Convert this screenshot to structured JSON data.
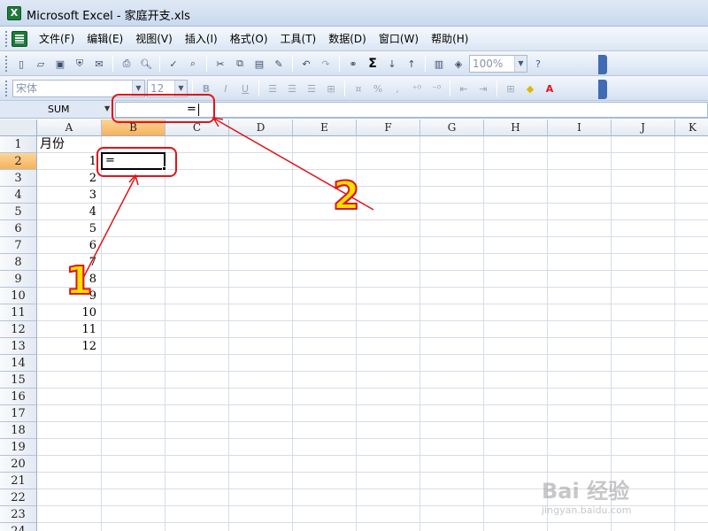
{
  "window": {
    "title": "Microsoft Excel - 家庭开支.xls",
    "app_icon": "excel-icon"
  },
  "menu": {
    "items": [
      "文件(F)",
      "编辑(E)",
      "视图(V)",
      "插入(I)",
      "格式(O)",
      "工具(T)",
      "数据(D)",
      "窗口(W)",
      "帮助(H)"
    ]
  },
  "standard_toolbar": {
    "zoom": "100%"
  },
  "format_toolbar": {
    "font_name": "宋体",
    "font_size": "12",
    "bold": "B",
    "italic": "I",
    "underline": "U",
    "percent": "%",
    "comma": ",",
    "font_color_letter": "A"
  },
  "formula_bar": {
    "name_box": "SUM",
    "content": "="
  },
  "grid": {
    "columns": [
      "A",
      "B",
      "C",
      "D",
      "E",
      "F",
      "G",
      "H",
      "I",
      "J",
      "K"
    ],
    "rows": [
      "1",
      "2",
      "3",
      "4",
      "5",
      "6",
      "7",
      "8",
      "9",
      "10",
      "11",
      "12",
      "13",
      "14",
      "15",
      "16",
      "17",
      "18",
      "19",
      "20",
      "21",
      "22",
      "23",
      "24"
    ],
    "active_column": "B",
    "active_row": "2",
    "a1_header": "月份",
    "a_values": [
      "1",
      "2",
      "3",
      "4",
      "5",
      "6",
      "7",
      "8",
      "9",
      "10",
      "11",
      "12"
    ],
    "active_cell_content": "="
  },
  "annotations": {
    "label_1": "1",
    "label_2": "2",
    "color": "#e0141b",
    "number_fill": "#f2e000"
  },
  "watermark": {
    "text": "Bai 经验",
    "url": "jingyan.baidu.com"
  }
}
